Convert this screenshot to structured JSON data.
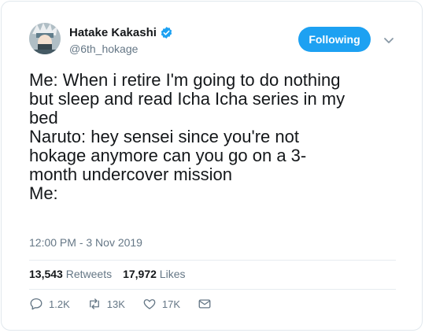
{
  "user": {
    "display_name": "Hatake Kakashi",
    "handle": "@6th_hokage",
    "verified": true
  },
  "follow_button": {
    "label": "Following"
  },
  "tweet": {
    "lines": [
      "Me: When i retire I'm going to do nothing",
      "but sleep and read Icha Icha series in my",
      "bed",
      "Naruto: hey sensei since you're not",
      "hokage anymore can you go on a 3-",
      "month undercover mission",
      "Me:"
    ],
    "timestamp": "12:00 PM - 3 Nov 2019"
  },
  "stats": {
    "retweets_count": "13,543",
    "retweets_label": "Retweets",
    "likes_count": "17,972",
    "likes_label": "Likes"
  },
  "actions": {
    "replies": "1.2K",
    "retweets": "13K",
    "likes": "17K"
  },
  "colors": {
    "accent": "#1da1f2",
    "text": "#14171a",
    "muted": "#657786",
    "border": "#e1e8ed"
  },
  "icons": {
    "verified": "verified-badge-icon",
    "caret": "chevron-down-icon",
    "reply": "reply-icon",
    "retweet": "retweet-icon",
    "like": "heart-icon",
    "message": "envelope-icon"
  }
}
